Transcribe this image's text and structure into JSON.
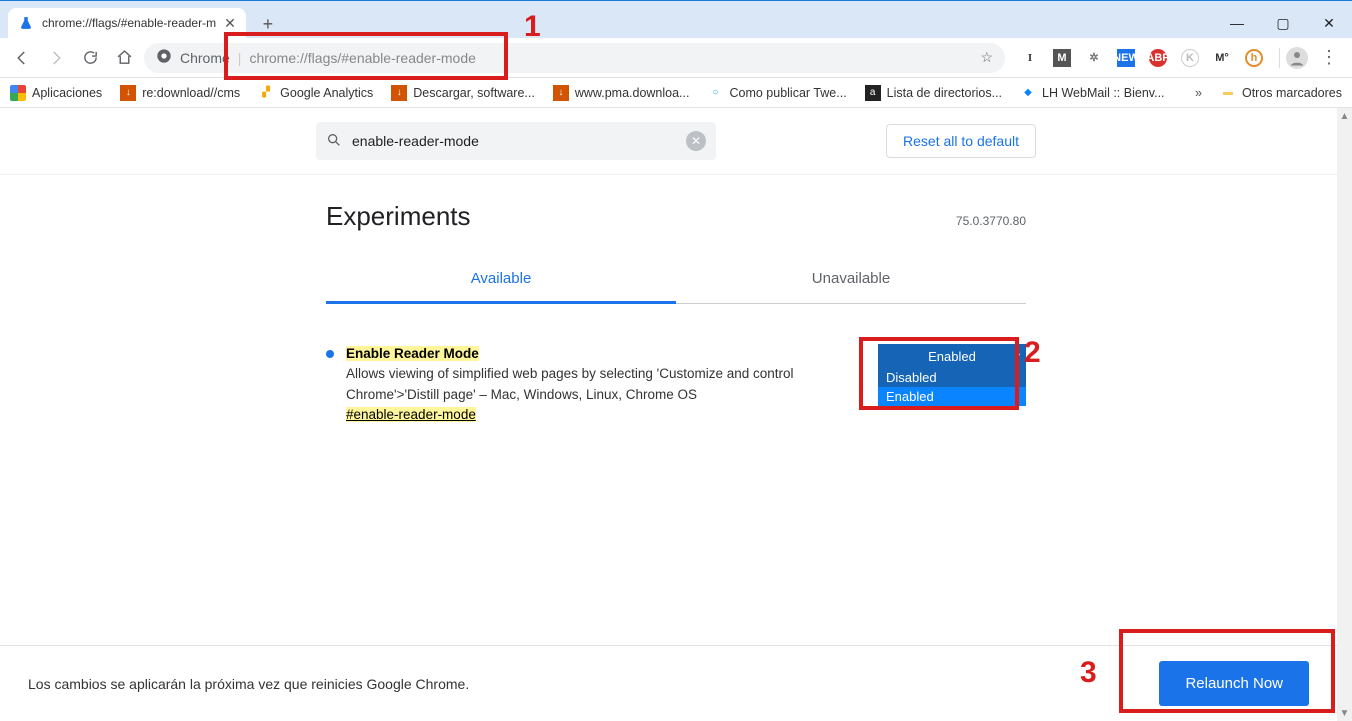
{
  "window": {
    "tab_title": "chrome://flags/#enable-reader-m",
    "minimize": "—",
    "maximize": "▢",
    "close": "✕"
  },
  "toolbar": {
    "prefix": "Chrome",
    "url": "chrome://flags/#enable-reader-mode",
    "back": "←",
    "forward": "→",
    "reload": "⟳",
    "home": "⌂"
  },
  "bookmarks": {
    "apps": "Aplicaciones",
    "b1": "re:download//cms",
    "b2": "Google Analytics",
    "b3": "Descargar, software...",
    "b4": "www.pma.downloa...",
    "b5": "Como publicar Twe...",
    "b6": "Lista de directorios...",
    "b7": "LH WebMail :: Bienv...",
    "more": "»",
    "other": "Otros marcadores"
  },
  "search": {
    "value": "enable-reader-mode",
    "reset": "Reset all to default"
  },
  "page": {
    "title": "Experiments",
    "version": "75.0.3770.80",
    "tab_available": "Available",
    "tab_unavailable": "Unavailable"
  },
  "flag": {
    "title": "Enable Reader Mode",
    "desc": "Allows viewing of simplified web pages by selecting 'Customize and control Chrome'>'Distill page' – Mac, Windows, Linux, Chrome OS",
    "hash": "#enable-reader-mode",
    "selected": "Enabled",
    "opt_disabled": "Disabled",
    "opt_enabled": "Enabled"
  },
  "bottom": {
    "msg": "Los cambios se aplicarán la próxima vez que reinicies Google Chrome.",
    "relaunch": "Relaunch Now"
  },
  "annot": {
    "n1": "1",
    "n2": "2",
    "n3": "3"
  }
}
